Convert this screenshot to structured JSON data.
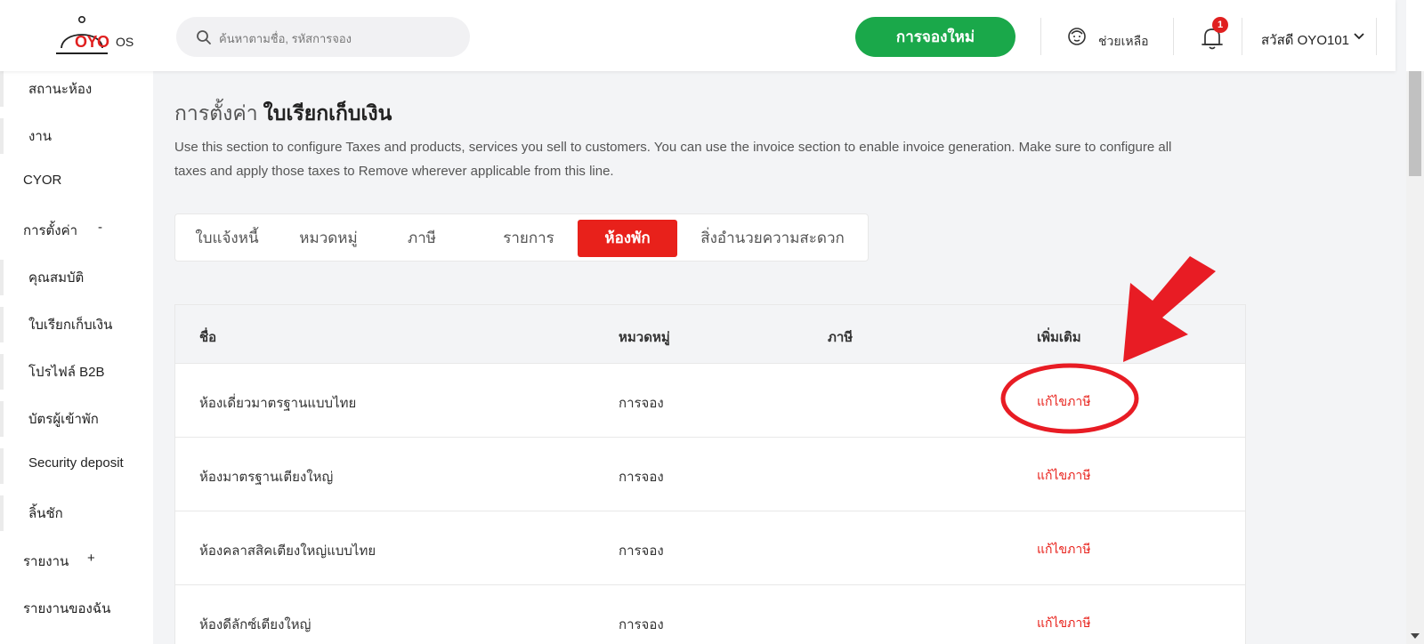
{
  "header": {
    "logo_text": "OYO",
    "logo_suffix": "OS",
    "search_placeholder": "ค้นหาตามชื่อ, รหัสการจอง",
    "new_booking_label": "การจองใหม่",
    "help_label": "ช่วยเหลือ",
    "notification_count": "1",
    "user_greeting": "สวัสดี OYO101"
  },
  "sidebar": {
    "items": [
      {
        "label": "สถานะห้อง",
        "level": "sub"
      },
      {
        "label": "งาน",
        "level": "sub"
      },
      {
        "label": "CYOR",
        "level": "top"
      },
      {
        "label": "การตั้งค่า",
        "level": "top",
        "sign": "-"
      },
      {
        "label": "คุณสมบัติ",
        "level": "sub"
      },
      {
        "label": "ใบเรียกเก็บเงิน",
        "level": "sub"
      },
      {
        "label": "โปรไฟล์ B2B",
        "level": "sub"
      },
      {
        "label": "บัตรผู้เข้าพัก",
        "level": "sub"
      },
      {
        "label": "Security deposit",
        "level": "sub"
      },
      {
        "label": "ลิ้นชัก",
        "level": "sub"
      },
      {
        "label": "รายงาน",
        "level": "top",
        "sign": "+"
      },
      {
        "label": "รายงานของฉัน",
        "level": "top"
      }
    ]
  },
  "page": {
    "title_prefix": "การตั้งค่า",
    "title_main": "ใบเรียกเก็บเงิน",
    "description": "Use this section to configure Taxes and products, services you sell to customers. You can use the invoice section to enable invoice generation. Make sure to configure all taxes and apply those taxes to Remove wherever applicable from this line."
  },
  "tabs": [
    {
      "label": "ใบแจ้งหนี้",
      "active": false
    },
    {
      "label": "หมวดหมู่",
      "active": false
    },
    {
      "label": "ภาษี",
      "active": false
    },
    {
      "label": "รายการ",
      "active": false
    },
    {
      "label": "ห้องพัก",
      "active": true
    },
    {
      "label": "สิ่งอำนวยความสะดวก",
      "active": false
    }
  ],
  "table": {
    "columns": [
      "ชื่อ",
      "หมวดหมู่",
      "ภาษี",
      "เพิ่มเติม"
    ],
    "rows": [
      {
        "name": "ห้องเดี่ยวมาตรฐานแบบไทย",
        "category": "การจอง",
        "tax": "",
        "action": "แก้ไขภาษี"
      },
      {
        "name": "ห้องมาตรฐานเตียงใหญ่",
        "category": "การจอง",
        "tax": "",
        "action": "แก้ไขภาษี"
      },
      {
        "name": "ห้องคลาสสิคเตียงใหญ่แบบไทย",
        "category": "การจอง",
        "tax": "",
        "action": "แก้ไขภาษี"
      },
      {
        "name": "ห้องดีลักซ์เตียงใหญ่",
        "category": "การจอง",
        "tax": "",
        "action": "แก้ไขภาษี"
      }
    ]
  },
  "colors": {
    "accent_red": "#e8211b",
    "brand_green": "#1aa84a",
    "annotation_red": "#e81c24"
  }
}
